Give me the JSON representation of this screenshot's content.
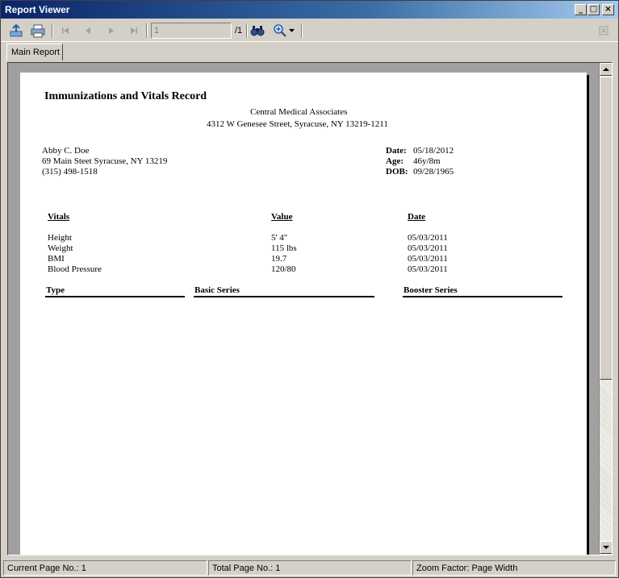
{
  "window": {
    "title": "Report Viewer"
  },
  "toolbar": {
    "page_input_value": "1",
    "page_total": "/1",
    "icons": [
      "export-icon",
      "print-icon",
      "first-page-icon",
      "prev-page-icon",
      "next-page-icon",
      "last-page-icon",
      "find-icon",
      "zoom-icon",
      "close-icon"
    ]
  },
  "tabs": [
    {
      "label": "Main Report"
    }
  ],
  "report": {
    "title": "Immunizations and Vitals Record",
    "org_name": "Central Medical Associates",
    "org_address": "4312 W Genesee Street, Syracuse, NY 13219-1211",
    "patient": {
      "name": "Abby C. Doe",
      "address": "69 Main Steet Syracuse, NY  13219",
      "phone": "(315) 498-1518"
    },
    "meta": {
      "date_label": "Date:",
      "date_value": "05/18/2012",
      "age_label": "Age:",
      "age_value": "46y/8m",
      "dob_label": "DOB:",
      "dob_value": "09/28/1965"
    },
    "vitals_headers": {
      "vitals": "Vitals",
      "value": "Value",
      "date": "Date"
    },
    "vitals": [
      {
        "name": "Height",
        "value": "5' 4\"",
        "date": "05/03/2011"
      },
      {
        "name": "Weight",
        "value": "115 lbs",
        "date": "05/03/2011"
      },
      {
        "name": "BMI",
        "value": "19.7",
        "date": "05/03/2011"
      },
      {
        "name": "Blood Pressure",
        "value": "120/80",
        "date": "05/03/2011"
      }
    ],
    "immunization_headers": {
      "type": "Type",
      "basic": "Basic Series",
      "booster": "Booster Series"
    }
  },
  "status": {
    "current_page": "Current Page No.: 1",
    "total_page": "Total Page No.: 1",
    "zoom": "Zoom Factor: Page Width"
  }
}
